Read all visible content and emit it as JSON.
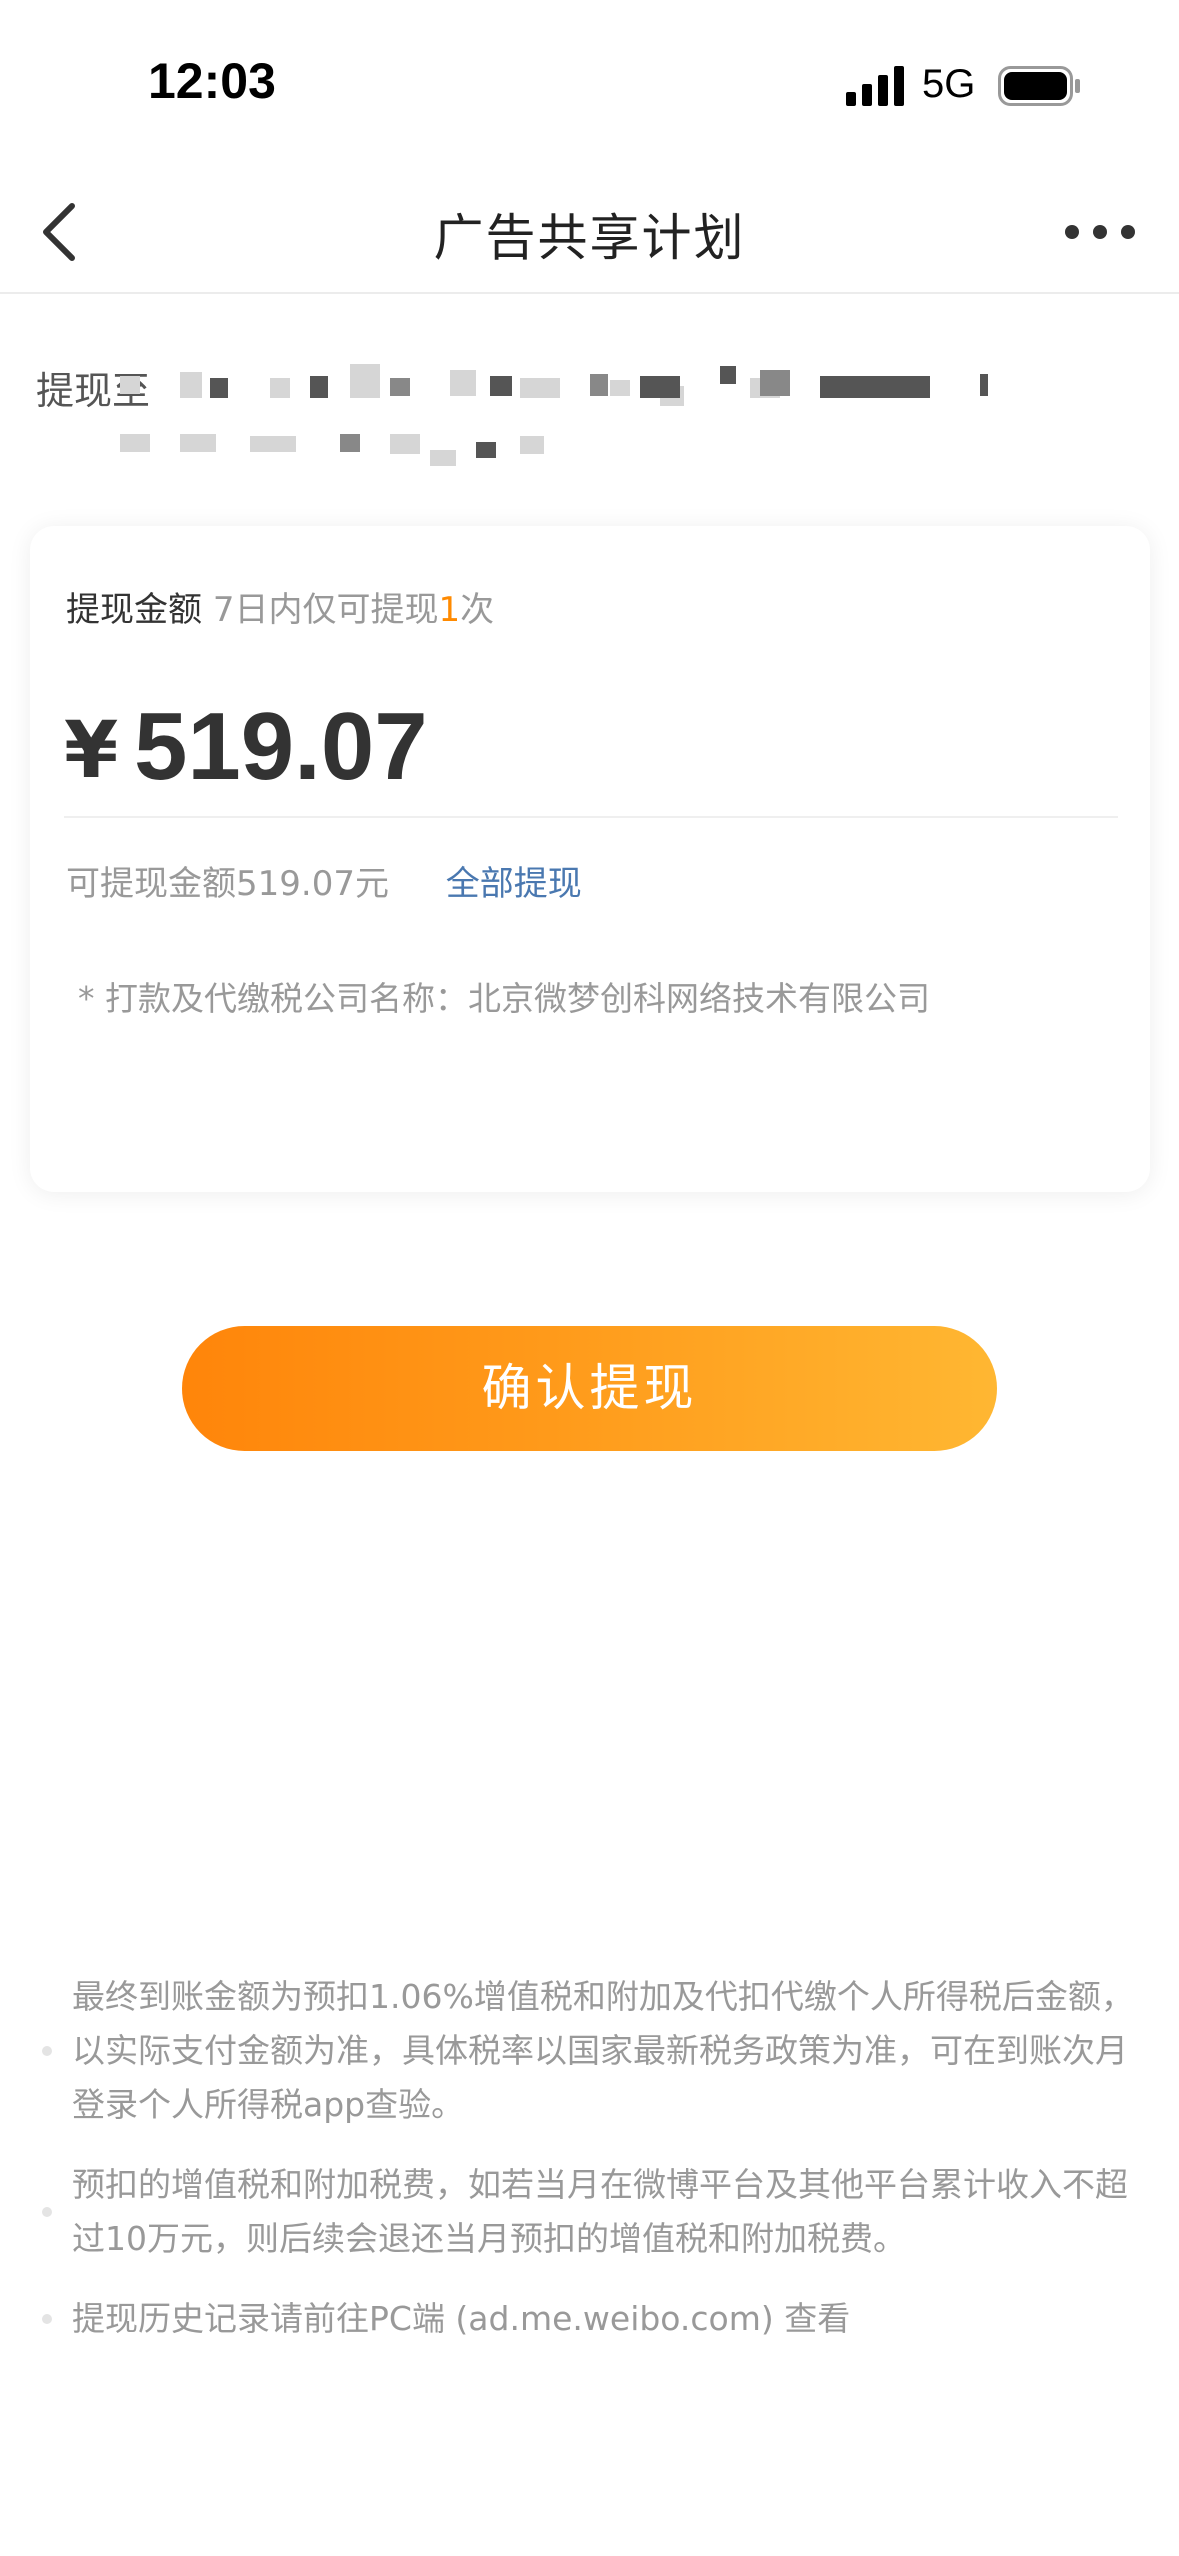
{
  "status_bar": {
    "time": "12:03",
    "network": "5G"
  },
  "nav": {
    "title": "广告共享计划"
  },
  "account": {
    "label": "提现至"
  },
  "withdraw": {
    "label": "提现金额",
    "limit_prefix": "7日内仅可提现",
    "limit_count": "1",
    "limit_suffix": "次",
    "currency": "¥",
    "amount": "519.07",
    "available_text": "可提现金额519.07元",
    "withdraw_all": "全部提现",
    "company_note": "* 打款及代缴税公司名称：北京微梦创科网络技术有限公司"
  },
  "confirm_button": "确认提现",
  "notes": [
    "最终到账金额为预扣1.06%增值税和附加及代扣代缴个人所得税后金额，以实际支付金额为准，具体税率以国家最新税务政策为准，可在到账次月登录个人所得税app查验。",
    "预扣的增值税和附加税费，如若当月在微博平台及其他平台累计收入不超过10万元，则后续会退还当月预扣的增值税和附加税费。",
    "提现历史记录请前往PC端 (ad.me.weibo.com) 查看"
  ],
  "colors": {
    "accent": "#ff8a00",
    "link": "#4a78b0",
    "button_gradient_start": "#ff850a",
    "button_gradient_end": "#ffb732"
  }
}
